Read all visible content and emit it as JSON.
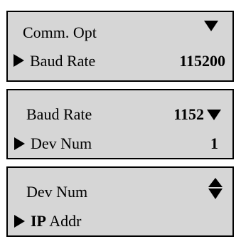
{
  "screens": [
    {
      "row1": {
        "label": "Comm. Opt"
      },
      "row2": {
        "label": "Baud Rate",
        "value": "115200"
      },
      "scroll_indicator": "down-arrow-icon"
    },
    {
      "row1": {
        "label": "Baud Rate",
        "value": "1152"
      },
      "row2": {
        "label": "Dev Num",
        "value": "1"
      },
      "scroll_indicator": "down-arrow-icon"
    },
    {
      "row1": {
        "label": "Dev Num"
      },
      "row2": {
        "label_bold": "IP",
        "label": "Addr"
      },
      "scroll_indicator": "up-down-arrow-icon"
    }
  ],
  "colors": {
    "panel_background": "#d6d6d6",
    "border": "#000000",
    "text": "#000000"
  }
}
